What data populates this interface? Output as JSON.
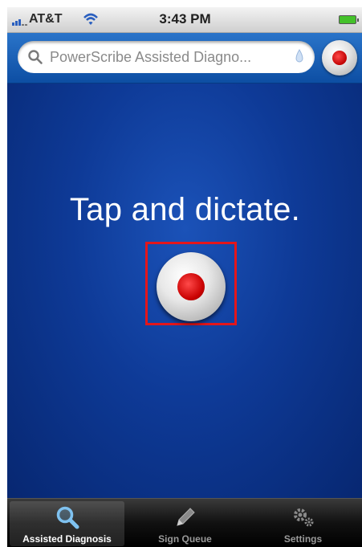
{
  "status_bar": {
    "carrier": "AT&T",
    "time": "3:43 PM",
    "icons": [
      "signal-icon",
      "wifi-icon",
      "battery-icon"
    ]
  },
  "search": {
    "placeholder": "PowerScribe Assisted Diagno...",
    "value": ""
  },
  "main": {
    "prompt": "Tap and dictate."
  },
  "tabs": [
    {
      "label": "Assisted Diagnosis",
      "icon": "magnifier-icon",
      "active": true
    },
    {
      "label": "Sign Queue",
      "icon": "pencil-icon",
      "active": false
    },
    {
      "label": "Settings",
      "icon": "gears-icon",
      "active": false
    }
  ],
  "colors": {
    "record_red": "#c80000",
    "highlight_red": "#e4161b",
    "background_blue": "#0e3a97"
  }
}
